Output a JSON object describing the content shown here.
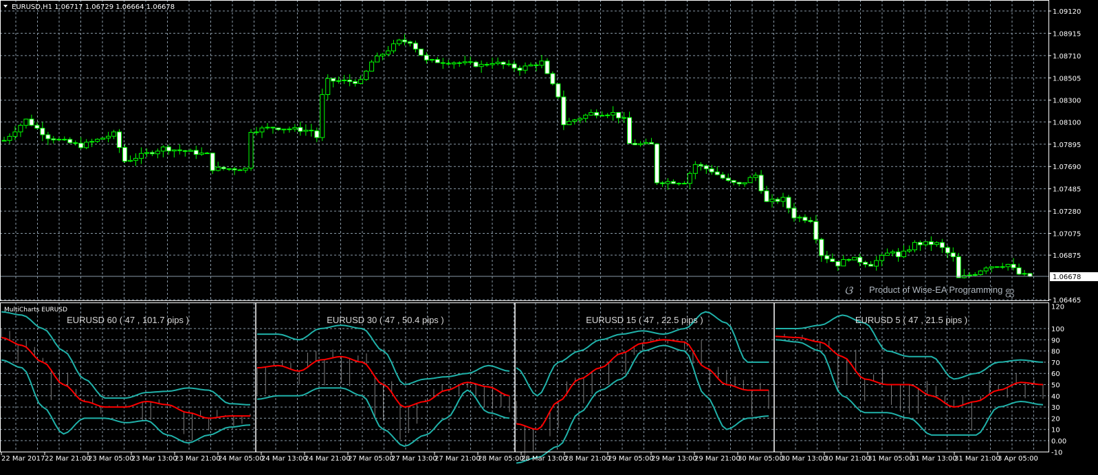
{
  "header": {
    "symbol_info": "EURUSD,H1  1.06717 1.06729 1.06664 1.06678"
  },
  "watermark": {
    "text": "Product of Wise-EA Programming"
  },
  "colors": {
    "bull": "#00ff00",
    "bear_fill": "#ffffff",
    "grid": "#8a9aa8",
    "upper_band": "#20b2aa",
    "middle": "#ff0000",
    "bars": "#808080"
  },
  "price_axis": {
    "labels": [
      "1.09120",
      "1.08915",
      "1.08710",
      "1.08505",
      "1.08300",
      "1.08100",
      "1.07895",
      "1.07690",
      "1.07485",
      "1.07280",
      "1.07075",
      "1.06875",
      "1.06465"
    ],
    "current": "1.06678",
    "range": [
      1.06465,
      1.0912
    ]
  },
  "indicator": {
    "title": "MultiCharts EURUSD",
    "axis_labels": [
      "120",
      "100",
      "90",
      "80",
      "70",
      "60",
      "50",
      "40",
      "30",
      "20",
      "10",
      "0.00",
      "-10"
    ],
    "axis_values": [
      120,
      100,
      90,
      80,
      70,
      60,
      50,
      40,
      30,
      20,
      10,
      0,
      -10
    ],
    "range": [
      -10,
      120
    ],
    "panels": [
      {
        "title": "EURUSD 60 ( 47 , 101.7 pips )",
        "upper": [
          115,
          112,
          100,
          80,
          55,
          38,
          38,
          43,
          44,
          47,
          45,
          33,
          32
        ],
        "middle": [
          92,
          85,
          70,
          50,
          35,
          30,
          30,
          35,
          32,
          25,
          20,
          22,
          22
        ],
        "lower": [
          72,
          65,
          30,
          6,
          20,
          20,
          16,
          18,
          5,
          -2,
          5,
          12,
          14
        ]
      },
      {
        "title": "EURUSD 30 ( 47 , 50.4 pips )",
        "upper": [
          95,
          95,
          90,
          100,
          103,
          100,
          80,
          50,
          55,
          57,
          60,
          67,
          62
        ],
        "middle": [
          65,
          67,
          62,
          72,
          75,
          70,
          50,
          30,
          35,
          45,
          52,
          48,
          40
        ],
        "lower": [
          37,
          40,
          40,
          47,
          47,
          40,
          10,
          -5,
          5,
          20,
          45,
          25,
          20
        ]
      },
      {
        "title": "EURUSD 15 ( 47 , 22.5 pips )",
        "upper": [
          65,
          40,
          70,
          80,
          90,
          95,
          98,
          95,
          100,
          115,
          105,
          70,
          70
        ],
        "middle": [
          15,
          10,
          35,
          55,
          65,
          78,
          87,
          90,
          88,
          65,
          50,
          45,
          45
        ],
        "lower": [
          -20,
          -15,
          -5,
          25,
          45,
          55,
          80,
          85,
          80,
          40,
          10,
          20,
          22
        ]
      },
      {
        "title": "EURUSD 5 ( 47 , 21.5 pips )",
        "upper": [
          100,
          100,
          103,
          112,
          105,
          80,
          75,
          75,
          55,
          60,
          70,
          72,
          70
        ],
        "middle": [
          93,
          92,
          88,
          75,
          55,
          50,
          50,
          40,
          30,
          35,
          45,
          52,
          50
        ],
        "lower": [
          90,
          88,
          80,
          40,
          25,
          25,
          20,
          5,
          5,
          5,
          30,
          35,
          32
        ]
      }
    ]
  },
  "time_axis": [
    "22 Mar 2017",
    "22 Mar 21:00",
    "23 Mar 05:00",
    "23 Mar 13:00",
    "23 Mar 21:00",
    "24 Mar 05:00",
    "24 Mar 13:00",
    "24 Mar 21:00",
    "27 Mar 05:00",
    "27 Mar 13:00",
    "27 Mar 21:00",
    "28 Mar 05:00",
    "28 Mar 13:00",
    "28 Mar 21:00",
    "29 Mar 05:00",
    "29 Mar 13:00",
    "29 Mar 21:00",
    "30 Mar 05:00",
    "30 Mar 13:00",
    "30 Mar 21:00",
    "31 Mar 05:00",
    "31 Mar 13:00",
    "31 Mar 21:00",
    "3 Apr 05:00"
  ],
  "chart_data": {
    "type": "candlestick",
    "candle_count": 188,
    "price_keyframes": [
      [
        0,
        1.0793
      ],
      [
        4,
        1.0812
      ],
      [
        8,
        1.0796
      ],
      [
        14,
        1.0788
      ],
      [
        20,
        1.0799
      ],
      [
        22,
        1.0774
      ],
      [
        29,
        1.0786
      ],
      [
        37,
        1.078
      ],
      [
        38,
        1.0767
      ],
      [
        44,
        1.0767
      ],
      [
        45,
        1.0802
      ],
      [
        49,
        1.0805
      ],
      [
        56,
        1.0802
      ],
      [
        57,
        1.0796
      ],
      [
        58,
        1.0834
      ],
      [
        59,
        1.0848
      ],
      [
        65,
        1.0847
      ],
      [
        67,
        1.0865
      ],
      [
        72,
        1.0884
      ],
      [
        74,
        1.0884
      ],
      [
        77,
        1.0866
      ],
      [
        82,
        1.0865
      ],
      [
        87,
        1.0862
      ],
      [
        89,
        1.0865
      ],
      [
        94,
        1.0859
      ],
      [
        98,
        1.0865
      ],
      [
        99,
        1.0853
      ],
      [
        101,
        1.0834
      ],
      [
        102,
        1.0808
      ],
      [
        107,
        1.0818
      ],
      [
        111,
        1.0818
      ],
      [
        113,
        1.0812
      ],
      [
        114,
        1.079
      ],
      [
        118,
        1.0789
      ],
      [
        119,
        1.0755
      ],
      [
        124,
        1.0755
      ],
      [
        126,
        1.0771
      ],
      [
        129,
        1.0765
      ],
      [
        132,
        1.0755
      ],
      [
        134,
        1.0752
      ],
      [
        137,
        1.0761
      ],
      [
        139,
        1.0736
      ],
      [
        142,
        1.0739
      ],
      [
        144,
        1.0723
      ],
      [
        147,
        1.072
      ],
      [
        148,
        1.0704
      ],
      [
        149,
        1.0688
      ],
      [
        152,
        1.0679
      ],
      [
        154,
        1.0685
      ],
      [
        158,
        1.0679
      ],
      [
        162,
        1.0692
      ],
      [
        163,
        1.0685
      ],
      [
        166,
        1.0698
      ],
      [
        170,
        1.0698
      ],
      [
        173,
        1.0685
      ],
      [
        174,
        1.0666
      ],
      [
        177,
        1.0671
      ],
      [
        179,
        1.0677
      ],
      [
        183,
        1.0679
      ],
      [
        185,
        1.067
      ],
      [
        187,
        1.0668
      ]
    ]
  }
}
